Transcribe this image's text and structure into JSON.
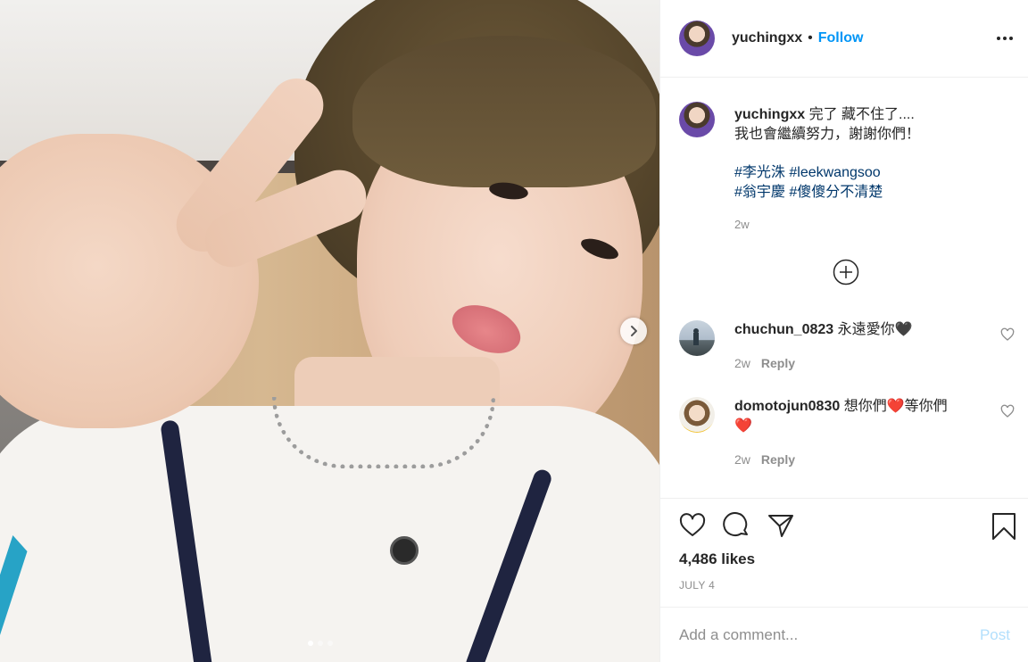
{
  "post": {
    "image_alt": "",
    "carousel": {
      "total": 3,
      "active": 1
    },
    "icons": {
      "next": "chevron-right-icon"
    }
  },
  "header": {
    "username": "yuchingxx",
    "separator": "•",
    "follow_label": "Follow",
    "more_icon": "more-horizontal-icon"
  },
  "caption": {
    "username": "yuchingxx",
    "line1": "完了 藏不住了....",
    "line2": "我也會繼續努力，謝謝你們！",
    "hashtags_row1": [
      "#李光洙",
      "#leekwangsoo"
    ],
    "hashtags_row2": [
      "#翁宇慶",
      "#傻傻分不清楚"
    ],
    "time": "2w"
  },
  "load_more_icon": "plus-circle-icon",
  "comments": [
    {
      "username": "chuchun_0823",
      "text": "永遠愛你",
      "emoji": "🖤",
      "time": "2w",
      "reply_label": "Reply"
    },
    {
      "username": "domotojun0830",
      "text_a": "想你們",
      "emoji_a": "❤️",
      "text_b": "等你們",
      "emoji_b": "❤️",
      "time": "2w",
      "reply_label": "Reply"
    }
  ],
  "actions": {
    "like_icon": "heart-outline-icon",
    "comment_icon": "comment-icon",
    "share_icon": "paper-plane-icon",
    "save_icon": "bookmark-icon"
  },
  "likes_text": "4,486 likes",
  "date_text": "JULY 4",
  "comment_input": {
    "placeholder": "Add a comment...",
    "value": ""
  },
  "post_label": "Post",
  "colors": {
    "link": "#0095f6",
    "hashtag": "#00376b",
    "muted": "#8e8e8e",
    "post_disabled": "#b2dffc"
  }
}
